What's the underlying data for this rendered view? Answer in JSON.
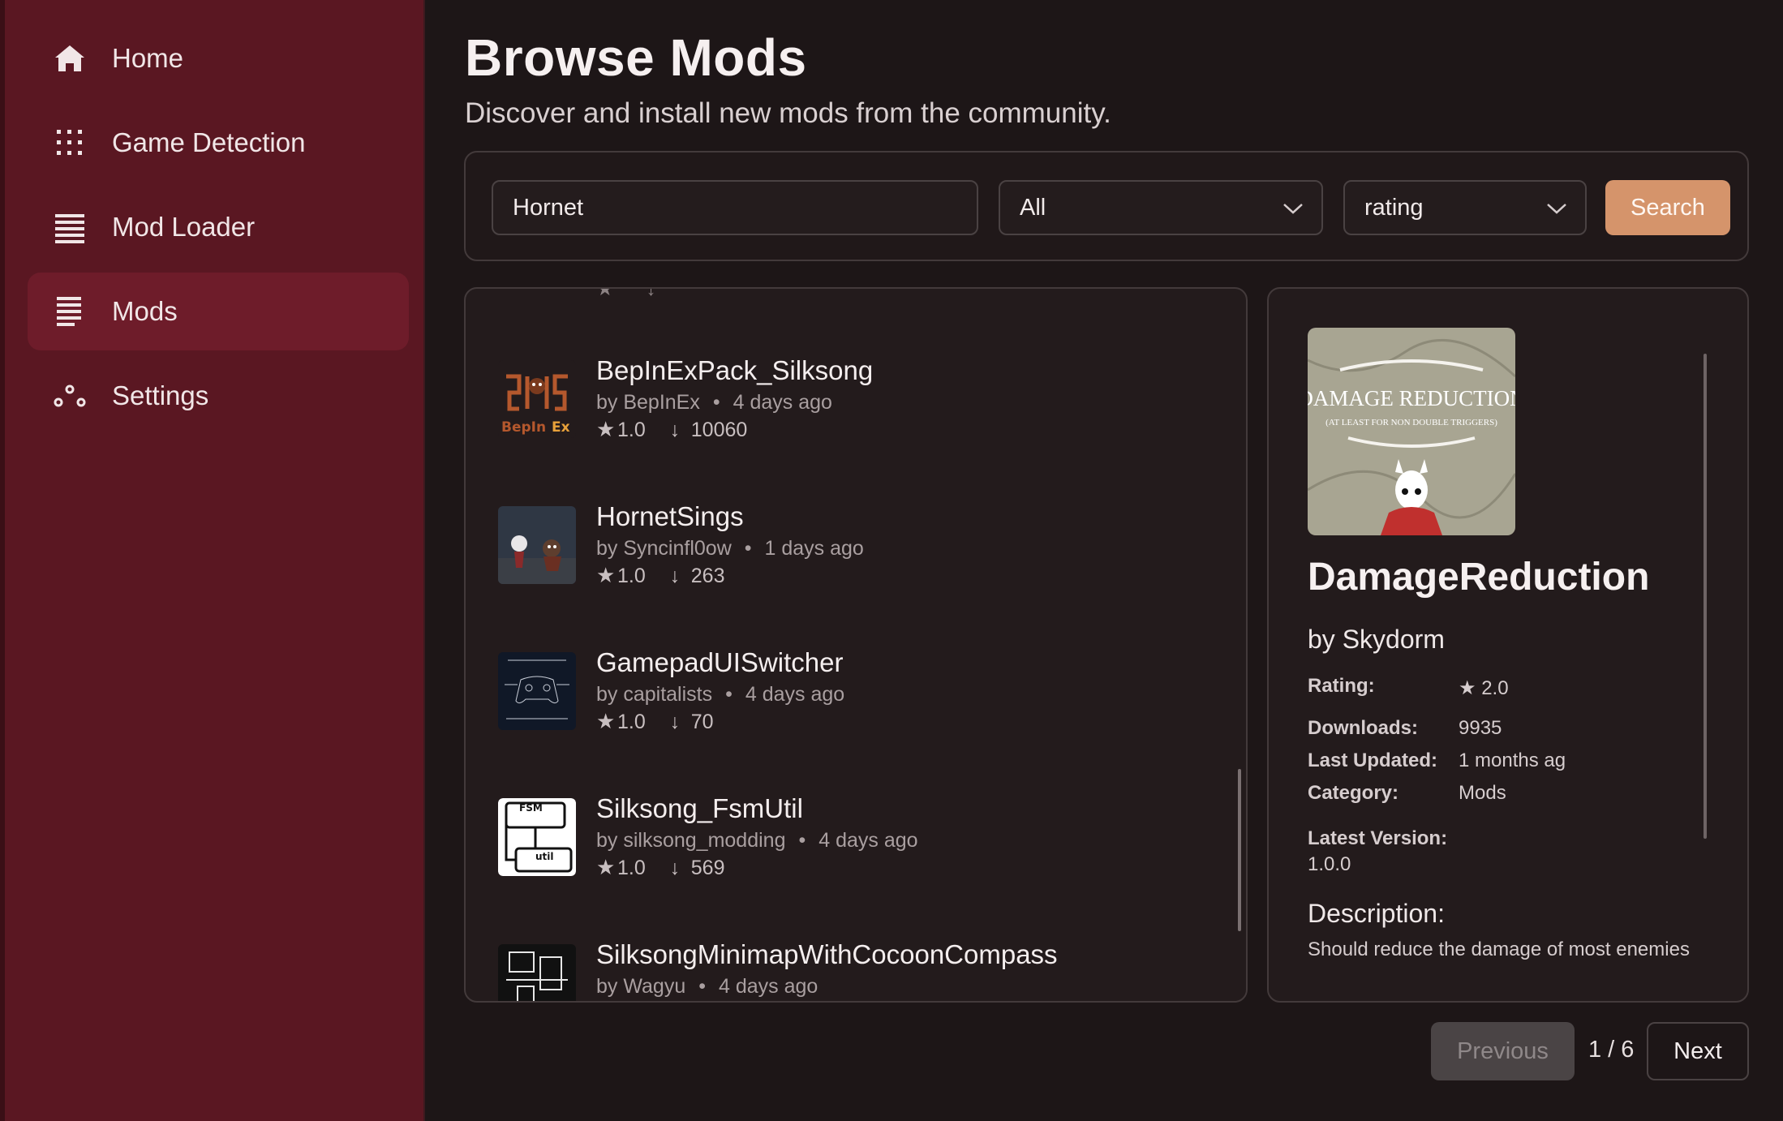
{
  "sidebar": {
    "items": [
      {
        "label": "Home",
        "icon": "home-icon"
      },
      {
        "label": "Game Detection",
        "icon": "grid-dots-icon"
      },
      {
        "label": "Mod Loader",
        "icon": "list-icon"
      },
      {
        "label": "Mods",
        "icon": "list-icon",
        "active": true
      },
      {
        "label": "Settings",
        "icon": "nodes-icon"
      }
    ]
  },
  "header": {
    "title": "Browse Mods",
    "subtitle": "Discover and install new mods from the community."
  },
  "search": {
    "query": "Hornet",
    "category": "All",
    "sort": "rating",
    "button": "Search"
  },
  "mods": [
    {
      "name": "BepInExPack_Silksong",
      "author": "by BepInEx",
      "updated": "4 days ago",
      "rating": "1.0",
      "downloads": "10060",
      "thumb": "bepinex-logo"
    },
    {
      "name": "HornetSings",
      "author": "by Syncinfl0ow",
      "updated": "1 days ago",
      "rating": "1.0",
      "downloads": "263",
      "thumb": "hornet-art"
    },
    {
      "name": "GamepadUISwitcher",
      "author": "by capitalists",
      "updated": "4 days ago",
      "rating": "1.0",
      "downloads": "70",
      "thumb": "gamepad-diagram"
    },
    {
      "name": "Silksong_FsmUtil",
      "author": "by silksong_modding",
      "updated": "4 days ago",
      "rating": "1.0",
      "downloads": "569",
      "thumb": "fsm-util-logo"
    },
    {
      "name": "SilksongMinimapWithCocoonCompass",
      "author": "by Wagyu",
      "updated": "4 days ago",
      "thumb": "minimap-art"
    }
  ],
  "detail": {
    "image_text": {
      "line1": "DAMAGE REDUCTION",
      "line2": "(AT LEAST FOR NON DOUBLE TRIGGERS)"
    },
    "title": "DamageReduction",
    "author": "by Skydorm",
    "rating_label": "Rating:",
    "rating": "2.0",
    "downloads_label": "Downloads:",
    "downloads": "9935",
    "updated_label": "Last Updated:",
    "updated": "1 months ag",
    "category_label": "Category:",
    "category": "Mods",
    "version_label": "Latest Version:",
    "version": "1.0.0",
    "description_heading": "Description:",
    "description": "Should reduce the damage of most enemies"
  },
  "pagination": {
    "previous": "Previous",
    "page": "1 / 6",
    "next": "Next"
  },
  "colors": {
    "sidebar": "#5a1722",
    "sidebar_active": "#6e1c2a",
    "background": "#1d1617",
    "accent": "#d5946b"
  },
  "symbols": {
    "star": "★",
    "download": "↓",
    "dot": "•"
  }
}
